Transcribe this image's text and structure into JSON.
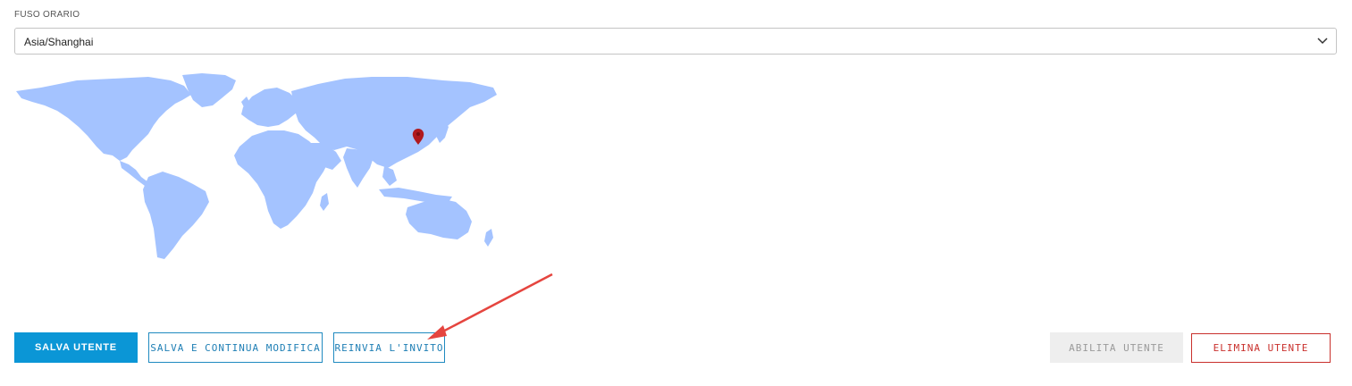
{
  "timezone": {
    "label": "FUSO ORARIO",
    "selected": "Asia/Shanghai"
  },
  "map": {
    "land_color": "#a4c3ff",
    "marker_color": "#b0191e",
    "marker_location": "Asia/Shanghai"
  },
  "actions": {
    "save": "SALVA UTENTE",
    "save_continue": "SALVA E CONTINUA MODIFICA",
    "resend_invite": "REINVIA L'INVITO",
    "enable": "ABILITA UTENTE",
    "delete": "ELIMINA UTENTE"
  },
  "colors": {
    "primary": "#0b96d6",
    "danger": "#c9302c",
    "annotation_arrow": "#e5453f"
  }
}
